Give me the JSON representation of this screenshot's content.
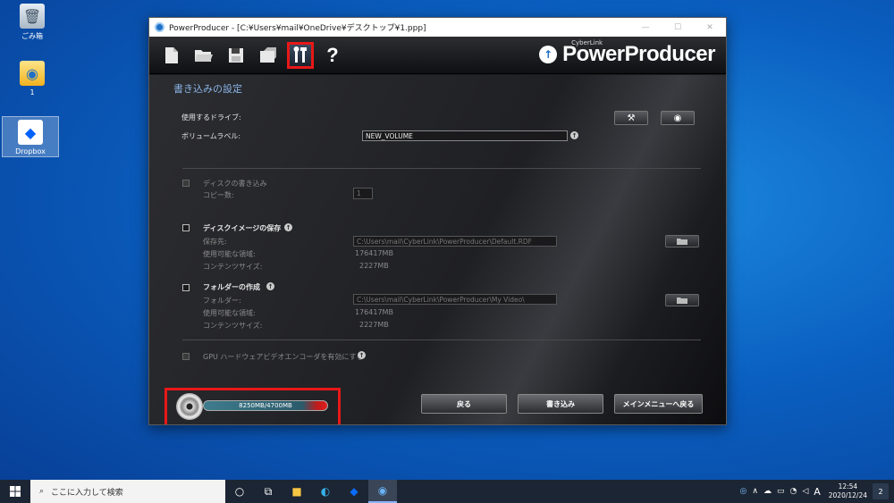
{
  "desktop": {
    "icons": [
      {
        "label": "ごみ箱"
      },
      {
        "label": "1"
      },
      {
        "label": "Dropbox"
      }
    ]
  },
  "window": {
    "title": "PowerProducer - [C:¥Users¥mail¥OneDrive¥デスクトップ¥1.ppp]",
    "brand_small": "CyberLink",
    "brand": "PowerProducer",
    "toolbar": {
      "buttons": [
        "new-file",
        "open-folder",
        "save",
        "export",
        "settings",
        "help"
      ],
      "help_label": "?"
    }
  },
  "burn_settings": {
    "heading": "書き込みの設定",
    "drive_label": "使用するドライブ:",
    "volume_label": "ボリュームラベル:",
    "volume_value": "NEW_VOLUME",
    "disc_write": {
      "label": "ディスクの書き込み",
      "copies_label": "コピー数:",
      "copies_value": "1"
    },
    "disc_image": {
      "label": "ディスクイメージの保存",
      "save_to_label": "保存先:",
      "save_to_value": "C:\\Users\\mail\\CyberLink\\PowerProducer\\Default.RDF",
      "free_space_label": "使用可能な領域:",
      "free_space_value": "176417MB",
      "content_size_label": "コンテンツサイズ:",
      "content_size_value": "2227MB"
    },
    "folder": {
      "label": "フォルダーの作成",
      "folder_label": "フォルダー:",
      "folder_value": "C:\\Users\\mail\\CyberLink\\PowerProducer\\My Video\\",
      "free_space_label": "使用可能な領域:",
      "free_space_value": "176417MB",
      "content_size_label": "コンテンツサイズ:",
      "content_size_value": "2227MB"
    },
    "gpu_label": "GPU ハードウェアビデオエンコーダを有効にする"
  },
  "capacity": {
    "text": "8250MB/4700MB",
    "used_mb": 8250,
    "capacity_mb": 4700
  },
  "actions": {
    "back": "戻る",
    "burn": "書き込み",
    "main_menu": "メインメニューへ戻る"
  },
  "taskbar": {
    "search_placeholder": "ここに入力して検索",
    "ime": "A",
    "time": "12:54",
    "date": "2020/12/24",
    "notifications": "2"
  }
}
